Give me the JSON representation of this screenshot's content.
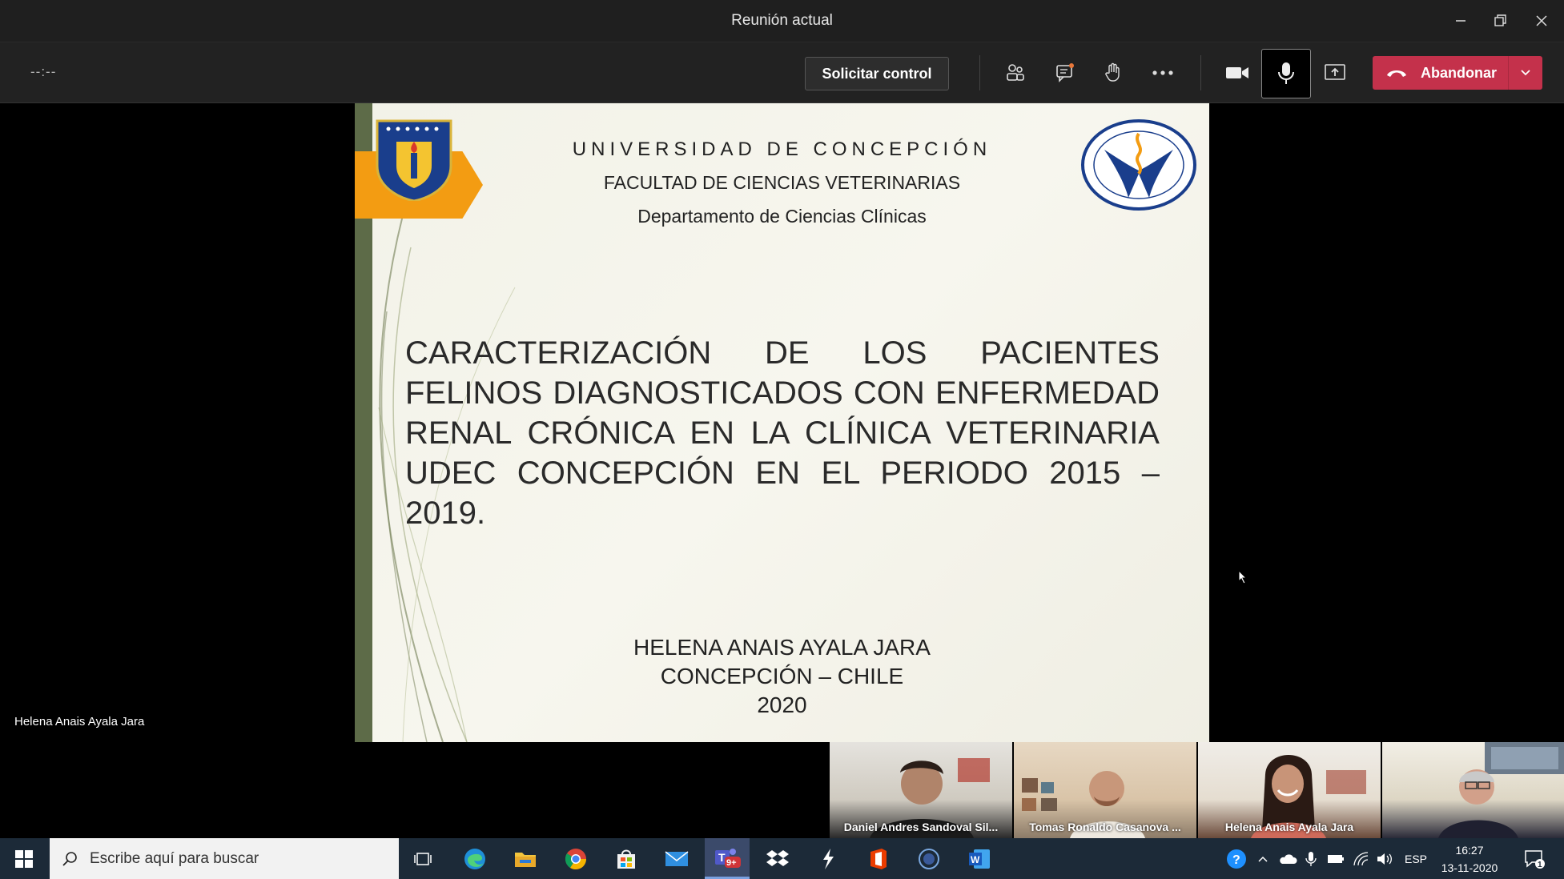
{
  "window": {
    "title": "Reunión actual"
  },
  "toolbar": {
    "timer": "--:--",
    "request_control_label": "Solicitar control",
    "leave_label": "Abandonar"
  },
  "slide": {
    "university": "UNIVERSIDAD DE CONCEPCIÓN",
    "faculty": "FACULTAD DE CIENCIAS VETERINARIAS",
    "department": "Departamento de Ciencias Clínicas",
    "title": "CARACTERIZACIÓN DE LOS PACIENTES FELINOS DIAGNOSTICADOS CON ENFERMEDAD RENAL CRÓNICA EN LA CLÍNICA VETERINARIA UDEC CONCEPCIÓN EN EL PERIODO 2015 – 2019.",
    "author": "HELENA ANAIS AYALA JARA",
    "location": "CONCEPCIÓN – CHILE",
    "year": "2020"
  },
  "presenter_label": "Helena Anais Ayala Jara",
  "participants": [
    {
      "name": "Daniel Andres Sandoval Sil..."
    },
    {
      "name": "Tomas Ronaldo Casanova ..."
    },
    {
      "name": "Helena Anais Ayala Jara"
    },
    {
      "name": ""
    }
  ],
  "taskbar": {
    "search_placeholder": "Escribe aquí para buscar",
    "teams_badge": "9+",
    "language": "ESP",
    "time": "16:27",
    "date": "13-11-2020",
    "notifications": "1"
  },
  "colors": {
    "leave_red": "#c4314b",
    "slide_sidebar": "#5d6b48",
    "slide_orange": "#f39c12",
    "taskbar": "#1c2a38"
  }
}
